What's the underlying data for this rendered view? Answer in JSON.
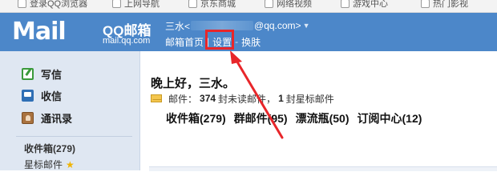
{
  "bookmarks": [
    {
      "label": "登录QQ浏览器"
    },
    {
      "label": "上网导航"
    },
    {
      "label": "京东商城"
    },
    {
      "label": "网络视频"
    },
    {
      "label": "游戏中心"
    },
    {
      "label": "热门影视"
    }
  ],
  "header": {
    "logo_mail": "Mail",
    "logo_brand": "QQ邮箱",
    "logo_domain": "mail.qq.com",
    "user_name": "三水<",
    "user_email_suffix": "@qq.com>",
    "nav": [
      {
        "label": "邮箱首页"
      },
      {
        "label": "设置"
      },
      {
        "label": "换肤"
      }
    ],
    "nav_sep": "|",
    "nav_sep2": "-"
  },
  "sidebar": {
    "items": [
      {
        "label": "写信",
        "icon": "compose-icon"
      },
      {
        "label": "收信",
        "icon": "inbox-icon"
      },
      {
        "label": "通讯录",
        "icon": "contacts-icon"
      }
    ],
    "inbox_label": "收件箱(279)",
    "starred_label": "星标邮件"
  },
  "main": {
    "greeting": "晚上好，三水。",
    "summary_prefix": "邮件：",
    "unread_count": "374",
    "unread_text": "封未读邮件，",
    "star_count": "1",
    "star_text": "封星标邮件",
    "folders": [
      {
        "label": "收件箱(279)"
      },
      {
        "label": "群邮件(95)"
      },
      {
        "label": "漂流瓶(50)"
      },
      {
        "label": "订阅中心(12)"
      }
    ]
  },
  "colors": {
    "header_bg": "#4c87c9",
    "sidebar_bg": "#dfe7f2",
    "highlight": "#e8262a"
  }
}
